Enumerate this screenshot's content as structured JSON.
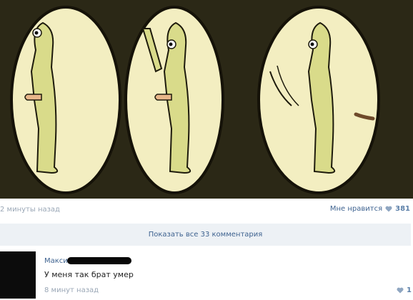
{
  "post": {
    "image_description_icon": "comic-image",
    "timestamp": "2 минуты назад",
    "like_label": "Мне нравится",
    "like_count": "381",
    "show_comments": "Показать все 33 комментария"
  },
  "comment": {
    "author": "Максим",
    "text": "У меня так брат умер",
    "time": "8 минут назад",
    "like_count": "1"
  },
  "colors": {
    "link": "#3f6390",
    "muted": "#9aa7b6",
    "heart": "#8fa6c1",
    "panel_bg": "#edf1f5"
  }
}
